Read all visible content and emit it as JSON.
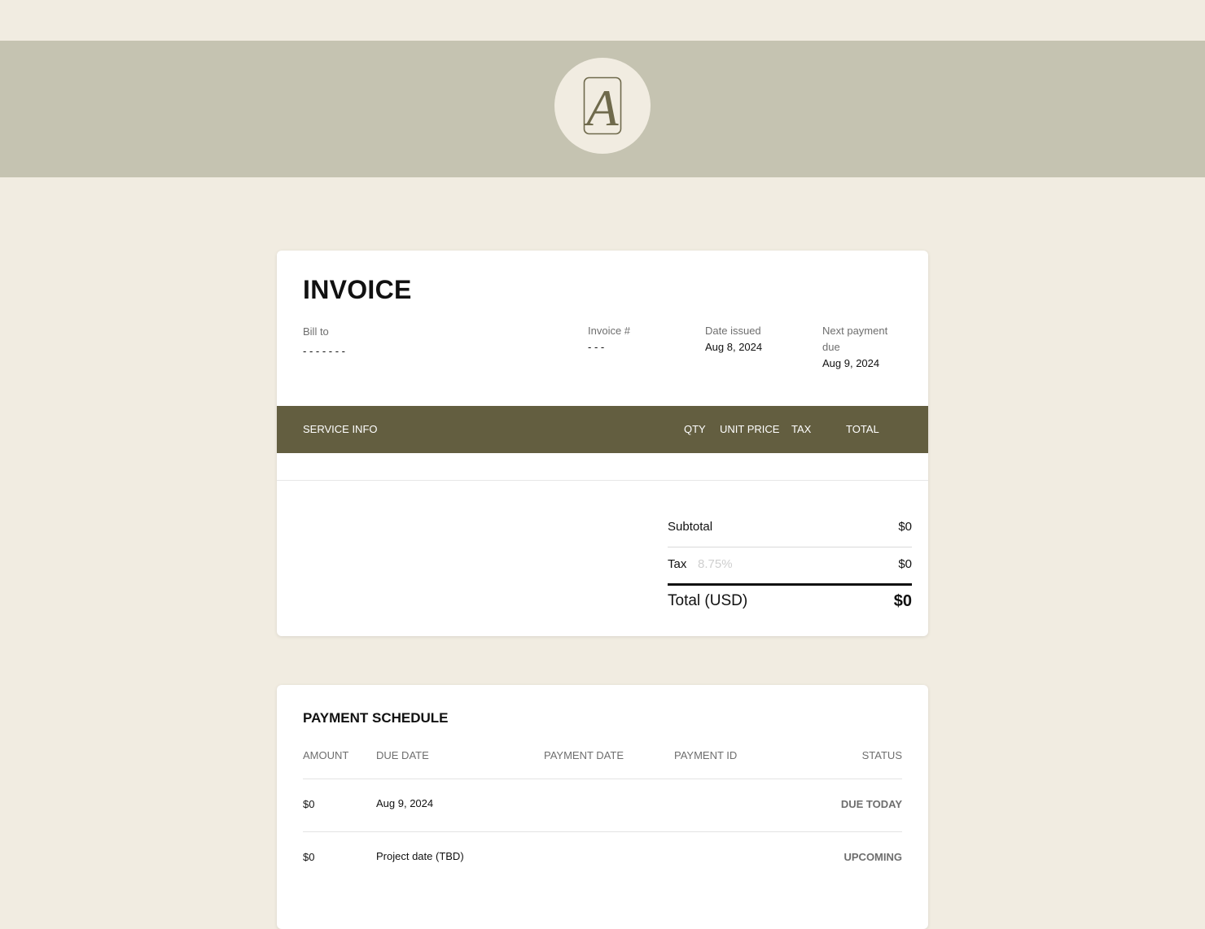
{
  "brand": {
    "logo_letter": "A",
    "banner_color": "#c5c3b1",
    "accent_color": "#635e40",
    "background_color": "#f1ece1"
  },
  "invoice": {
    "title": "INVOICE",
    "bill_to": {
      "label": "Bill to",
      "value": "- - - - - - -"
    },
    "invoice_number": {
      "label": "Invoice #",
      "value": "- - -"
    },
    "date_issued": {
      "label": "Date issued",
      "value": "Aug 8, 2024"
    },
    "next_payment_due": {
      "label_line1": "Next payment",
      "label_line2": "due",
      "value": "Aug 9, 2024"
    },
    "service_table": {
      "columns": {
        "service_info": "SERVICE INFO",
        "qty": "QTY",
        "unit_price": "UNIT PRICE",
        "tax": "TAX",
        "total": "TOTAL"
      },
      "rows": []
    },
    "totals": {
      "subtotal_label": "Subtotal",
      "subtotal_value": "$0",
      "tax_label": "Tax",
      "tax_rate": "8.75%",
      "tax_value": "$0",
      "total_label": "Total (USD)",
      "total_value": "$0"
    }
  },
  "payment_schedule": {
    "title": "PAYMENT SCHEDULE",
    "columns": {
      "amount": "AMOUNT",
      "due_date": "DUE DATE",
      "payment_date": "PAYMENT DATE",
      "payment_id": "PAYMENT ID",
      "status": "STATUS"
    },
    "rows": [
      {
        "amount": "$0",
        "due_date": "Aug 9, 2024",
        "payment_date": "",
        "payment_id": "",
        "status": "DUE TODAY"
      },
      {
        "amount": "$0",
        "due_date": "Project date (TBD)",
        "payment_date": "",
        "payment_id": "",
        "status": "UPCOMING"
      }
    ]
  }
}
